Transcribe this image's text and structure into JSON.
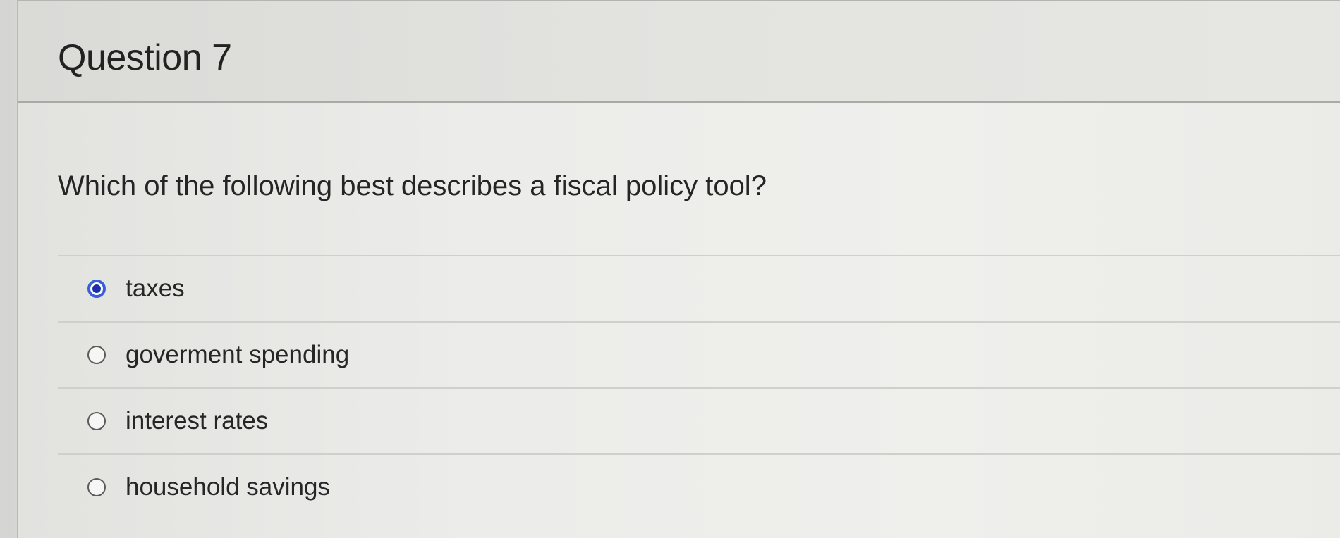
{
  "question": {
    "title": "Question 7",
    "prompt": "Which of the following best describes a fiscal policy tool?",
    "options": [
      {
        "label": "taxes",
        "selected": true
      },
      {
        "label": "goverment spending",
        "selected": false
      },
      {
        "label": "interest rates",
        "selected": false
      },
      {
        "label": "household savings",
        "selected": false
      }
    ]
  },
  "colors": {
    "radio_selected": "#1b2fa8",
    "radio_selected_ring": "#3b5ed6",
    "text": "#222222"
  }
}
